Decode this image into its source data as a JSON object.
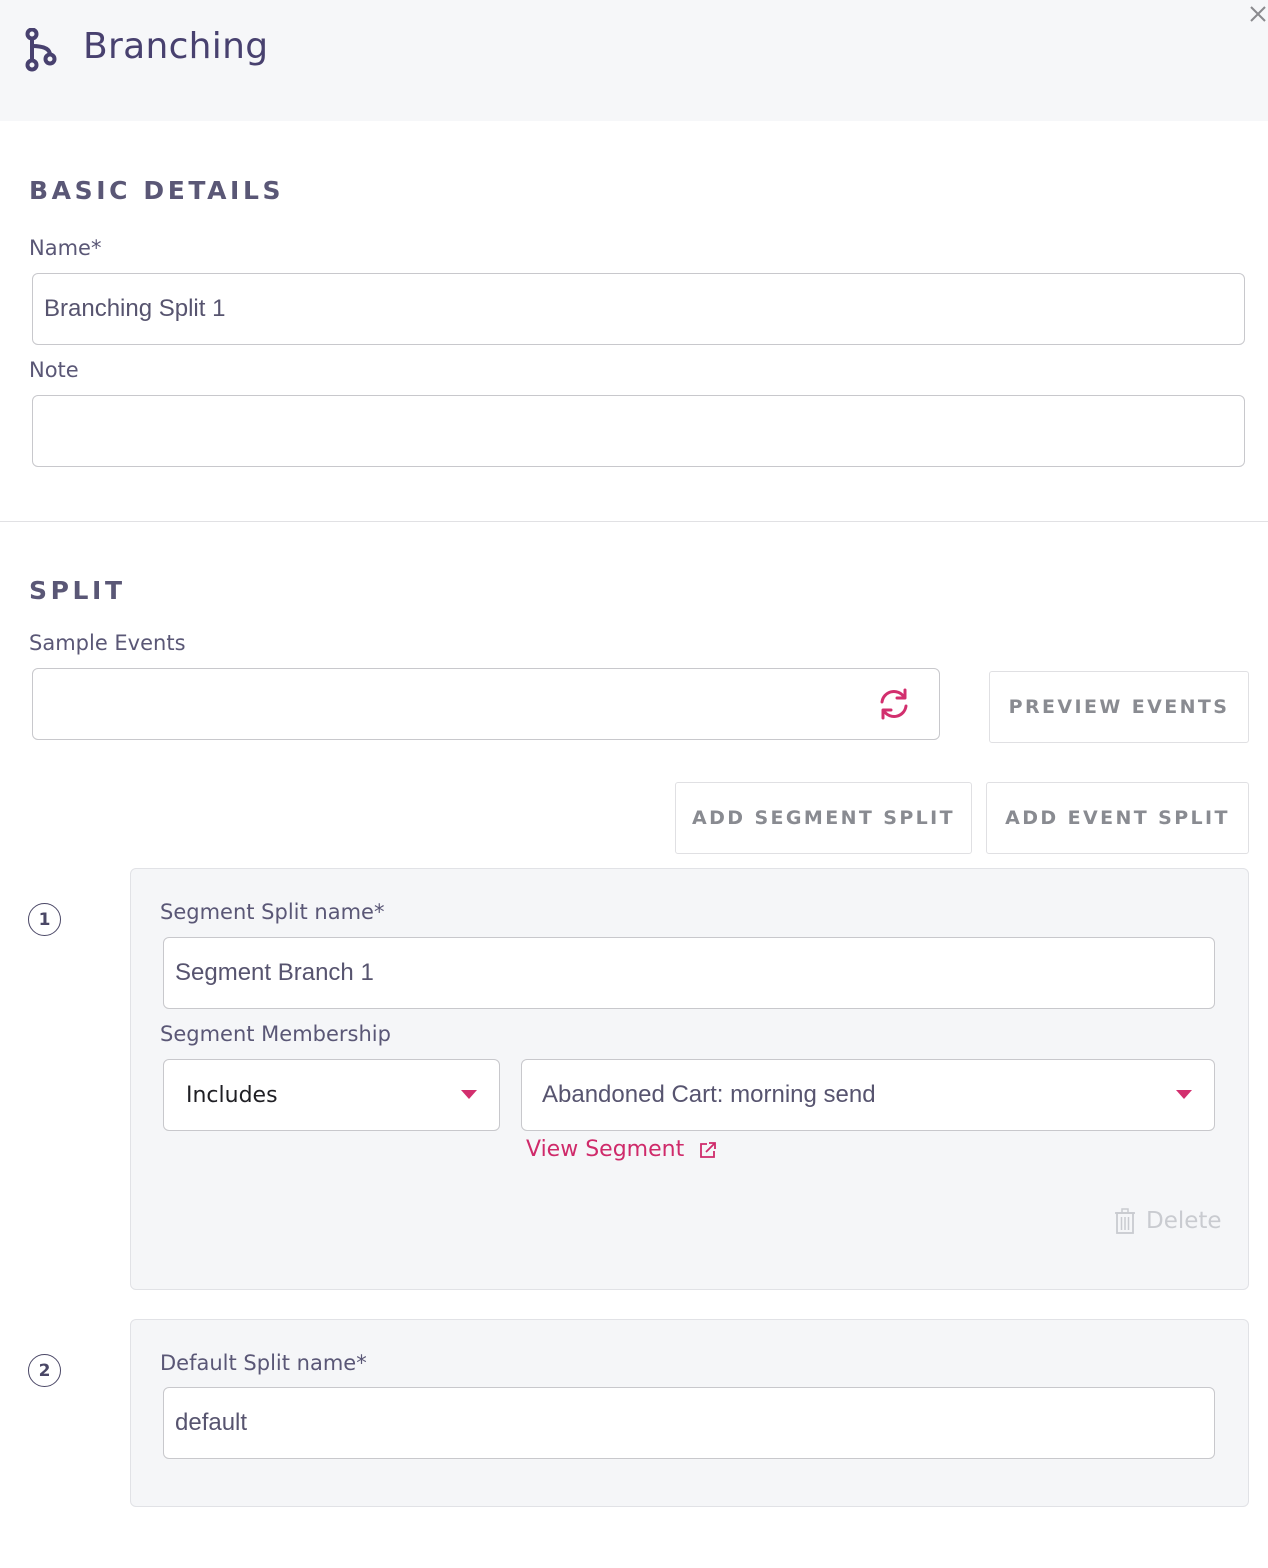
{
  "header": {
    "title": "Branching",
    "icon": "branch-icon",
    "close_icon": "close-icon"
  },
  "basic_details": {
    "section_title": "BASIC DETAILS",
    "name_label": "Name*",
    "name_value": "Branching Split 1",
    "note_label": "Note",
    "note_value": ""
  },
  "split": {
    "section_title": "SPLIT",
    "sample_events_label": "Sample Events",
    "sample_events_value": "",
    "refresh_icon": "refresh-icon",
    "preview_events_label": "PREVIEW EVENTS",
    "add_segment_split_label": "ADD SEGMENT SPLIT",
    "add_event_split_label": "ADD EVENT SPLIT"
  },
  "splits": [
    {
      "number": "1",
      "name_label": "Segment Split name*",
      "name_value": "Segment Branch 1",
      "membership_label": "Segment Membership",
      "membership_operator": "Includes",
      "segment_value": "Abandoned Cart: morning send",
      "view_segment_label": "View Segment",
      "delete_label": "Delete"
    },
    {
      "number": "2",
      "name_label": "Default Split name*",
      "name_value": "default"
    }
  ],
  "colors": {
    "accent": "#d22f6e",
    "title": "#48416f",
    "panel_bg": "#f5f6f8"
  }
}
